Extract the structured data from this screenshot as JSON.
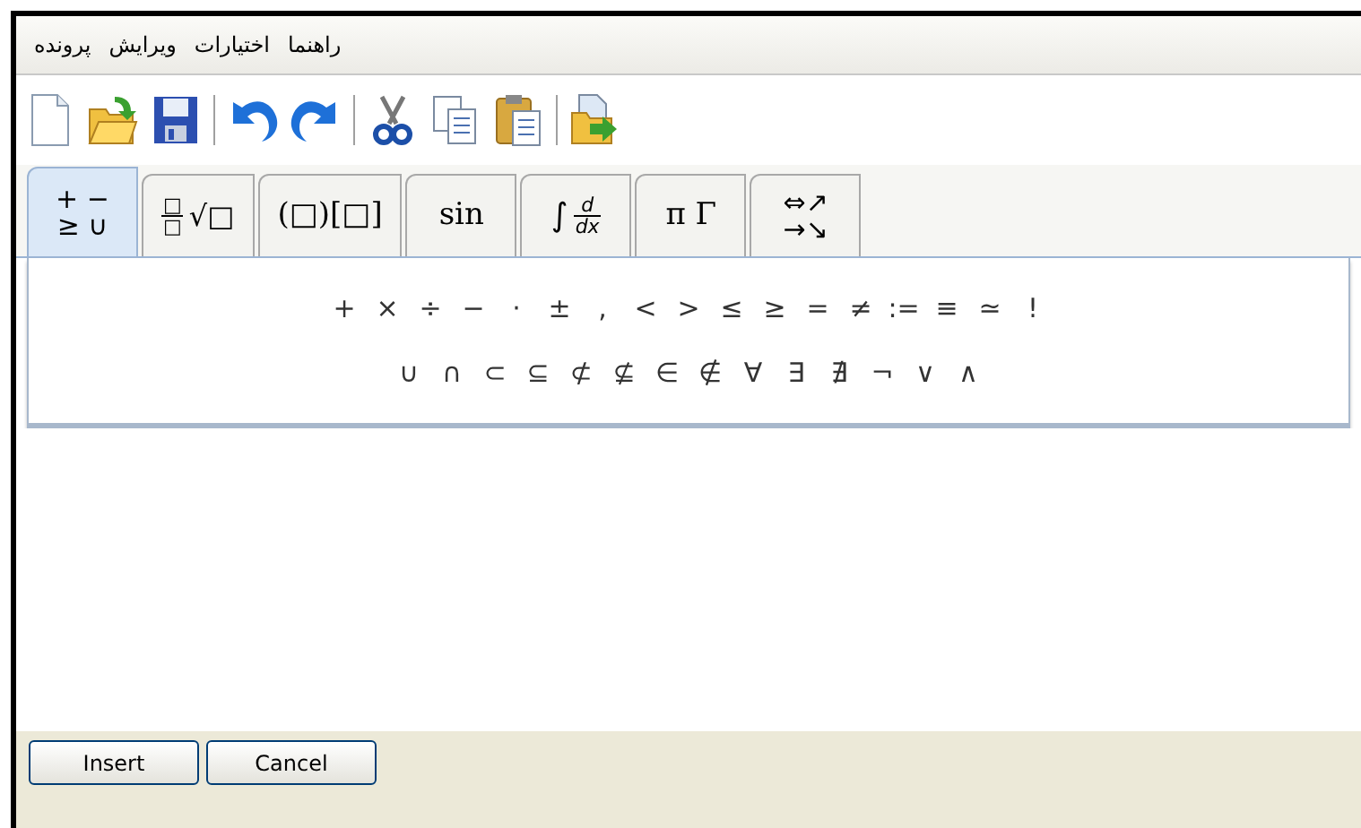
{
  "menu": [
    "راهنما",
    "اختیارات",
    "ویرایش",
    "پرونده"
  ],
  "toolbar": [
    {
      "kind": "export"
    },
    {
      "kind": "separator"
    },
    {
      "kind": "paste"
    },
    {
      "kind": "copy"
    },
    {
      "kind": "cut"
    },
    {
      "kind": "separator"
    },
    {
      "kind": "redo"
    },
    {
      "kind": "undo"
    },
    {
      "kind": "separator"
    },
    {
      "kind": "save"
    },
    {
      "kind": "open"
    },
    {
      "kind": "new"
    }
  ],
  "tabs": [
    {
      "kind": "stacked",
      "lines": [
        "⇔↗",
        "→↘"
      ],
      "selected": false
    },
    {
      "kind": "inline",
      "text": "π Γ",
      "selected": false
    },
    {
      "kind": "fraction",
      "before": "∫",
      "numerator": "d",
      "denominator": "dx",
      "selected": false
    },
    {
      "kind": "inline",
      "text": "sin",
      "selected": false
    },
    {
      "kind": "inline",
      "text": "(□)[□]",
      "selected": false
    },
    {
      "kind": "fraction",
      "numerator": "□",
      "denominator": "□",
      "after": "√□",
      "selected": false
    },
    {
      "kind": "stacked",
      "lines": [
        "+ −",
        "≥ ∪"
      ],
      "selected": true
    }
  ],
  "symbol_rows": [
    [
      "!",
      "≃",
      "≡",
      ":=",
      "≠",
      "=",
      "≥",
      "≤",
      ">",
      "<",
      ",",
      "±",
      "·",
      "−",
      "÷",
      "×",
      "+"
    ],
    [
      "∧",
      "∨",
      "¬",
      "∄",
      "∃",
      "∀",
      "∉",
      "∈",
      "⊈",
      "⊄",
      "⊆",
      "⊂",
      "∩",
      "∪"
    ]
  ],
  "buttons": [
    "Cancel",
    "Insert"
  ]
}
